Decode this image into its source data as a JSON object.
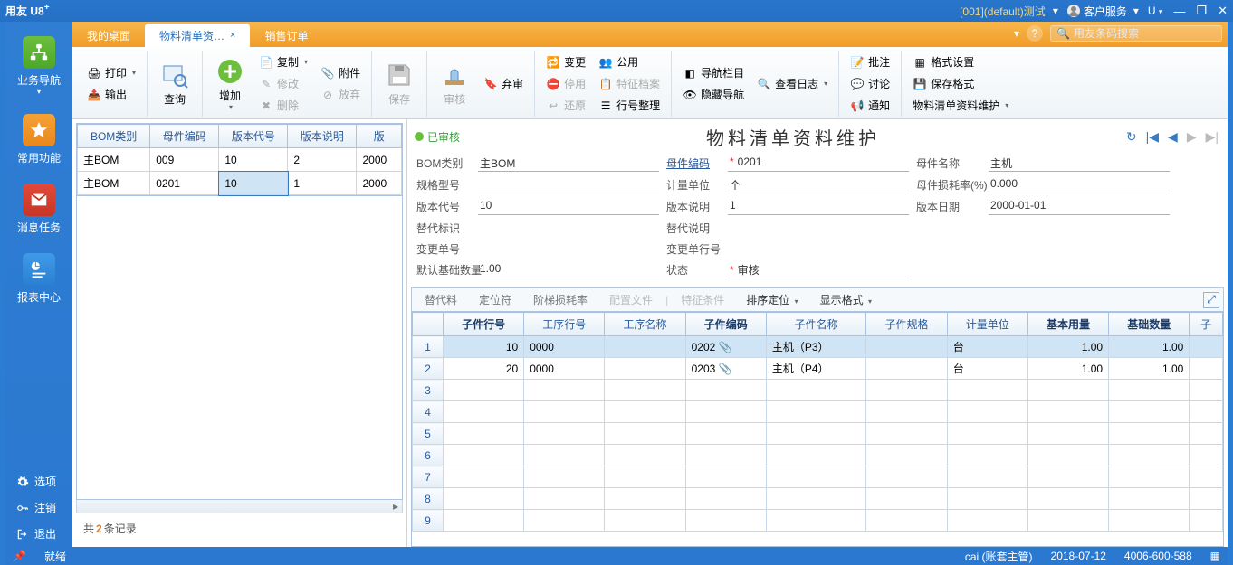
{
  "titlebar": {
    "app": "用友 U8",
    "sup": "+",
    "session": "[001](default)测试",
    "service": "客户服务",
    "u": "U"
  },
  "tabs": {
    "t0": "我的桌面",
    "t1": "物料清单资…",
    "t2": "销售订单"
  },
  "search": {
    "placeholder": "用友条码搜索"
  },
  "sidebar": {
    "n0": "业务导航",
    "n1": "常用功能",
    "n2": "消息任务",
    "n3": "报表中心",
    "opt": "选项",
    "logout": "注销",
    "exit": "退出"
  },
  "ribbon": {
    "print": "打印",
    "export": "输出",
    "query": "查询",
    "add": "增加",
    "copy": "复制",
    "modify": "修改",
    "delete": "删除",
    "attach": "附件",
    "abandon": "放弃",
    "save": "保存",
    "audit": "审核",
    "unaudit": "弃审",
    "change": "变更",
    "public": "公用",
    "stop": "停用",
    "spec": "特征档案",
    "restore": "还原",
    "rowfix": "行号整理",
    "navbar": "导航栏目",
    "log": "查看日志",
    "hidenav": "隐藏导航",
    "note": "批注",
    "discuss": "讨论",
    "notify": "通知",
    "fmtset": "格式设置",
    "fmtsave": "保存格式",
    "module": "物料清单资料维护"
  },
  "leftgrid": {
    "h0": "BOM类别",
    "h1": "母件编码",
    "h2": "版本代号",
    "h3": "版本说明",
    "h4": "版",
    "rows": [
      {
        "c0": "主BOM",
        "c1": "009",
        "c2": "10",
        "c3": "2",
        "c4": "2000"
      },
      {
        "c0": "主BOM",
        "c1": "0201",
        "c2": "10",
        "c3": "1",
        "c4": "2000"
      }
    ],
    "count_pre": "共",
    "count_n": "2",
    "count_suf": "条记录"
  },
  "doc": {
    "audited": "已审核",
    "title": "物料清单资料维护",
    "labels": {
      "bomtype": "BOM类别",
      "parentcode": "母件编码",
      "parentname": "母件名称",
      "spec": "规格型号",
      "unit": "计量单位",
      "lossrate": "母件损耗率(%)",
      "ver": "版本代号",
      "verdesc": "版本说明",
      "verdate": "版本日期",
      "subst": "替代标识",
      "substdesc": "替代说明",
      "chgno": "变更单号",
      "chgline": "变更单行号",
      "baseqty": "默认基础数量",
      "status": "状态"
    },
    "values": {
      "bomtype": "主BOM",
      "parentcode": "0201",
      "parentname": "主机",
      "spec": "",
      "unit": "个",
      "lossrate": "0.000",
      "ver": "10",
      "verdesc": "1",
      "verdate": "2000-01-01",
      "subst": "",
      "substdesc": "",
      "chgno": "",
      "chgline": "",
      "baseqty": "1.00",
      "status": "审核"
    }
  },
  "dtabs": {
    "t0": "替代料",
    "t1": "定位符",
    "t2": "阶梯损耗率",
    "t3": "配置文件",
    "t4": "特征条件",
    "t5": "排序定位",
    "t6": "显示格式"
  },
  "dgrid": {
    "h": {
      "rownum": "",
      "line": "子件行号",
      "proc": "工序行号",
      "procname": "工序名称",
      "code": "子件编码",
      "name": "子件名称",
      "spec": "子件规格",
      "unit": "计量单位",
      "base": "基本用量",
      "qty": "基础数量",
      "last": "子"
    },
    "rows": [
      {
        "n": "1",
        "line": "10",
        "proc": "0000",
        "code": "0202",
        "name": "主机（P3）",
        "unit": "台",
        "base": "1.00",
        "qty": "1.00"
      },
      {
        "n": "2",
        "line": "20",
        "proc": "0000",
        "code": "0203",
        "name": "主机（P4）",
        "unit": "台",
        "base": "1.00",
        "qty": "1.00"
      },
      {
        "n": "3"
      },
      {
        "n": "4"
      },
      {
        "n": "5"
      },
      {
        "n": "6"
      },
      {
        "n": "7"
      },
      {
        "n": "8"
      },
      {
        "n": "9"
      }
    ]
  },
  "status": {
    "ready": "就绪",
    "user": "cai (账套主管)",
    "date": "2018-07-12",
    "phone": "4006-600-588"
  }
}
